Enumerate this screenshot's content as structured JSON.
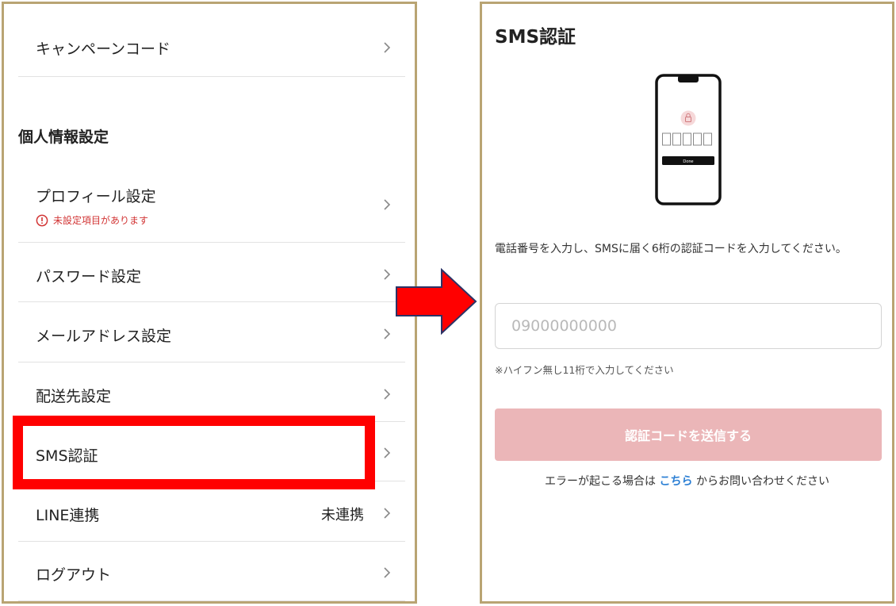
{
  "left": {
    "campaign_code": "キャンペーンコード",
    "section_title": "個人情報設定",
    "profile": "プロフィール設定",
    "profile_warning": "未設定項目があります",
    "password": "パスワード設定",
    "email": "メールアドレス設定",
    "shipping": "配送先設定",
    "sms": "SMS認証",
    "line": "LINE連携",
    "line_status": "未連携",
    "logout": "ログアウト"
  },
  "right": {
    "title": "SMS認証",
    "phone_screen_button": "Done",
    "description": "電話番号を入力し、SMSに届く6桁の認証コードを入力してください。",
    "phone_placeholder": "09000000000",
    "hint": "※ハイフン無し11桁で入力してください",
    "send_button": "認証コードを送信する",
    "error_prefix": "エラーが起こる場合は",
    "error_link": "こちら",
    "error_suffix": "からお問い合わせください"
  },
  "colors": {
    "panel_border": "#b9a473",
    "highlight": "#ff0000",
    "warning": "#d23535",
    "button_disabled": "#ebb6b8",
    "link": "#2b7fd4"
  }
}
